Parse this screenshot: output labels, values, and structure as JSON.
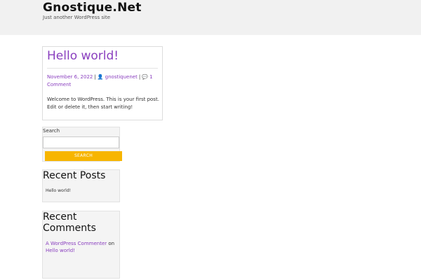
{
  "header": {
    "site_title": "Gnostique.Net",
    "tagline": "Just another WordPress site"
  },
  "post": {
    "title": "Hello world!",
    "date": "November 6, 2022",
    "author": "gnostiquenet",
    "comments": "1 Comment",
    "content": "Welcome to WordPress. This is your first post. Edit or delete it, then start writing!"
  },
  "search_widget": {
    "label": "Search",
    "input_value": "",
    "button_label": "SEARCH",
    "button_color": "#f7b500"
  },
  "recent_posts": {
    "title": "Recent Posts",
    "items": [
      "Hello world!"
    ]
  },
  "recent_comments": {
    "title": "Recent Comments",
    "commenter": "A WordPress Commenter",
    "on_word": "on",
    "post_link": "Hello world!"
  },
  "colors": {
    "link": "#8a3fbf",
    "header_bg": "#f1f1f1"
  },
  "icons": [
    "user-icon",
    "comments-icon"
  ]
}
